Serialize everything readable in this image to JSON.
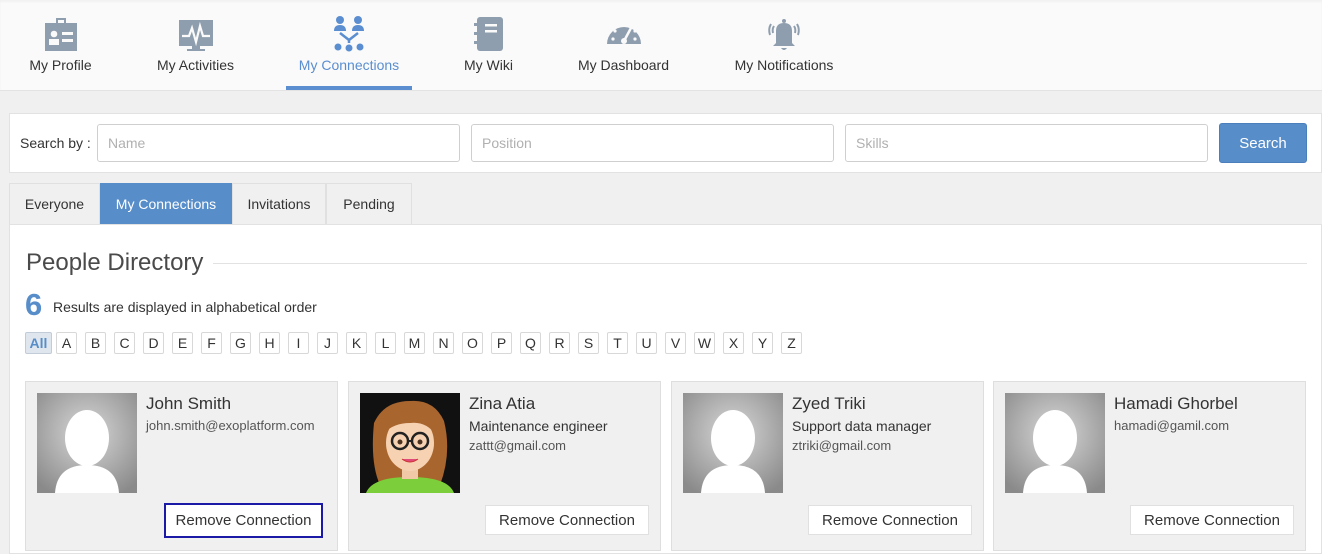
{
  "nav": {
    "items": [
      {
        "label": "My Profile",
        "icon": "profile-card-icon"
      },
      {
        "label": "My Activities",
        "icon": "activity-icon"
      },
      {
        "label": "My Connections",
        "icon": "connections-icon",
        "active": true
      },
      {
        "label": "My Wiki",
        "icon": "wiki-notebook-icon"
      },
      {
        "label": "My Dashboard",
        "icon": "dashboard-gauge-icon"
      },
      {
        "label": "My Notifications",
        "icon": "bell-icon"
      }
    ]
  },
  "search": {
    "label": "Search by :",
    "name_placeholder": "Name",
    "position_placeholder": "Position",
    "skills_placeholder": "Skills",
    "button_label": "Search"
  },
  "tabs": [
    {
      "label": "Everyone"
    },
    {
      "label": "My Connections",
      "active": true
    },
    {
      "label": "Invitations"
    },
    {
      "label": "Pending"
    }
  ],
  "directory": {
    "title": "People Directory",
    "count": "6",
    "order_text": "Results are displayed in alphabetical order",
    "letters": [
      "All",
      "A",
      "B",
      "C",
      "D",
      "E",
      "F",
      "G",
      "H",
      "I",
      "J",
      "K",
      "L",
      "M",
      "N",
      "O",
      "P",
      "Q",
      "R",
      "S",
      "T",
      "U",
      "V",
      "W",
      "X",
      "Y",
      "Z"
    ],
    "active_letter": "All"
  },
  "people": [
    {
      "name": "John Smith",
      "position": "",
      "email": "john.smith@exoplatform.com",
      "avatar": "default-avatar",
      "button": "Remove Connection"
    },
    {
      "name": "Zina Atia",
      "position": "Maintenance engineer",
      "email": "zattt@gmail.com",
      "avatar": "cartoon-woman-avatar",
      "button": "Remove Connection"
    },
    {
      "name": "Zyed Triki",
      "position": "Support data manager",
      "email": "ztriki@gmail.com",
      "avatar": "default-avatar",
      "button": "Remove Connection"
    },
    {
      "name": "Hamadi Ghorbel",
      "position": "",
      "email": "hamadi@gamil.com",
      "avatar": "default-avatar",
      "button": "Remove Connection"
    }
  ],
  "colors": {
    "accent": "#578dc9",
    "icon_gray": "#8a9aab"
  }
}
